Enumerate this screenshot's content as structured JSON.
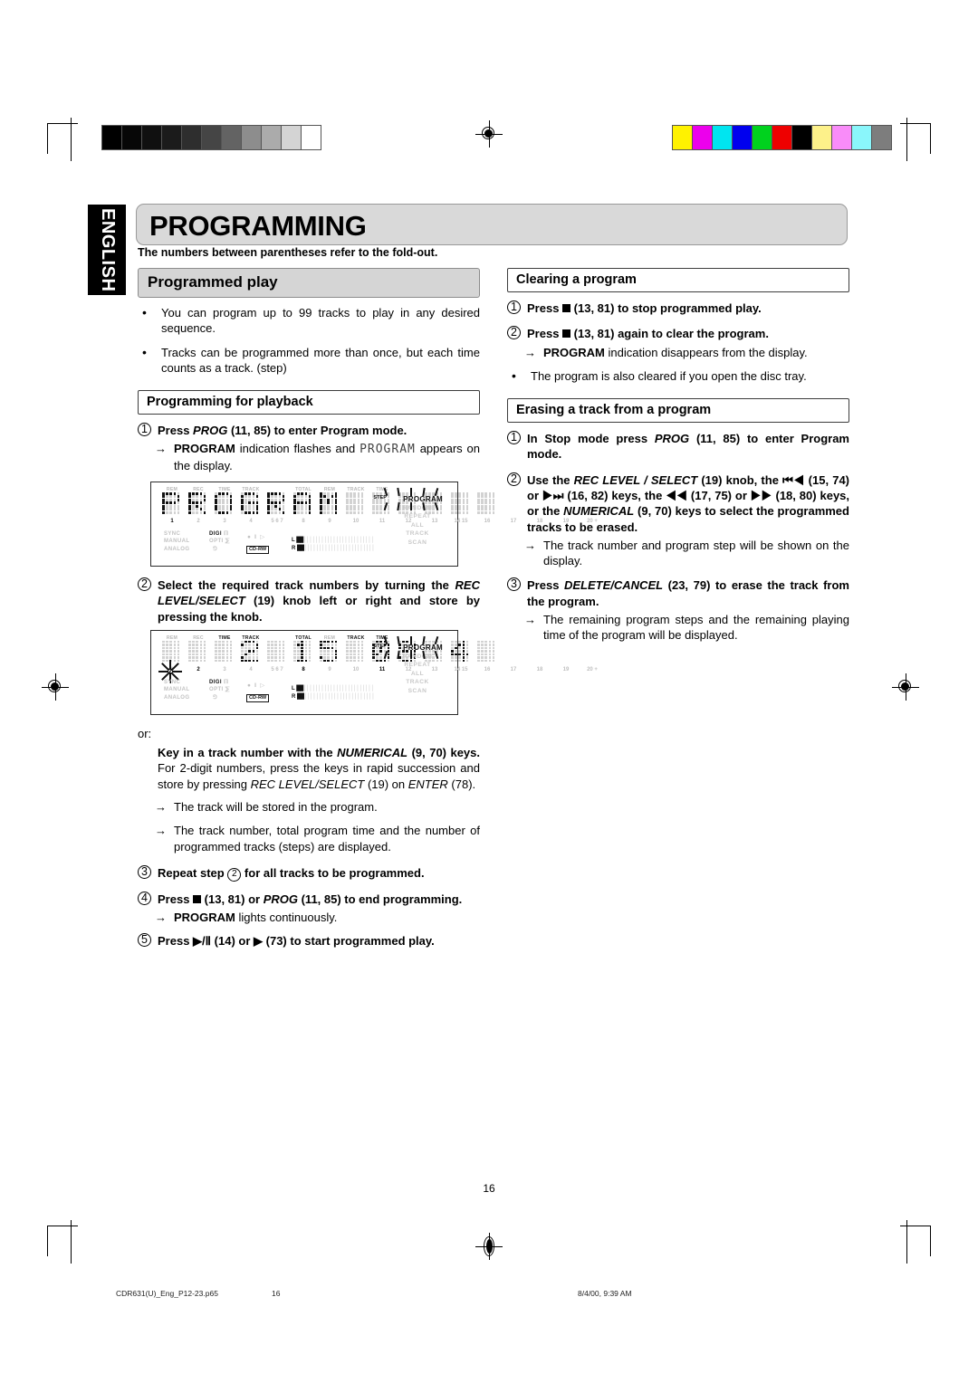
{
  "page": {
    "language_tab": "ENGLISH",
    "chapter_title": "PROGRAMMING",
    "note": "The numbers between parentheses refer to the fold-out.",
    "page_number": "16"
  },
  "footer": {
    "file": "CDR631(U)_Eng_P12-23.p65",
    "page": "16",
    "timestamp": "8/4/00, 9:39 AM"
  },
  "left_column": {
    "section_title": "Programmed play",
    "bullets": [
      "You can program up to 99 tracks to play in any desired sequence.",
      "Tracks can be programmed more than once, but each time counts as a track. (step)"
    ],
    "subsection_title": "Programming for playback",
    "step1": {
      "marker": "1",
      "text_pre": "Press ",
      "text_em": "PROG",
      "text_post": " (11, 85) to enter Program mode.",
      "result_pre": "PROGRAM",
      "result_mid": " indication flashes and ",
      "result_lcd": "PROGRAM",
      "result_post": " appears on the display."
    },
    "step2": {
      "marker": "2",
      "line1_pre": "Select the required track numbers by turning the ",
      "line1_em": "REC LEVEL/SELECT",
      "line1_post": " (19) knob left or right and store by pressing the knob."
    },
    "or_label": "or:",
    "keyin": {
      "bold_pre": "Key in a track number with the ",
      "bold_em": "NUMERICAL",
      "bold_post": " (9, 70) keys.",
      "rest_a": " For 2-digit numbers, press the keys in rapid succession and store by pressing ",
      "rest_em": "REC LEVEL/SELECT",
      "rest_b": " (19) on ",
      "rest_em2": "ENTER",
      "rest_c": " (78).",
      "arrow1": "The track will be stored in the program.",
      "arrow2": "The track number, total program time and the number of programmed tracks (steps) are displayed."
    },
    "step3": {
      "marker": "3",
      "text_a": "Repeat step ",
      "ref": "2",
      "text_b": " for all tracks to be programmed."
    },
    "step4": {
      "marker": "4",
      "text_a": "Press ",
      "text_b": " (13, 81) or ",
      "em": "PROG",
      "text_c": " (11, 85) to end programming.",
      "result_bold": "PROGRAM",
      "result_rest": " lights continuously."
    },
    "step5": {
      "marker": "5",
      "text_a": "Press ",
      "glyph1": "▶/Ⅱ",
      "text_b": " (14) or ",
      "glyph2": "▶",
      "text_c": " (73) to start programmed play."
    }
  },
  "right_column": {
    "section1_title": "Clearing a program",
    "s1_step1": {
      "marker": "1",
      "text_a": "Press ",
      "text_b": " (13, 81) to stop programmed play."
    },
    "s1_step2": {
      "marker": "2",
      "text_a": "Press ",
      "text_b": " (13, 81) again to clear the program.",
      "result_bold": "PROGRAM",
      "result_rest": " indication disappears from the display."
    },
    "s1_bullet": "The program is also cleared if you open the disc tray.",
    "section2_title": "Erasing a track from a program",
    "s2_step1": {
      "marker": "1",
      "text_a": "In Stop mode press ",
      "em": "PROG",
      "text_b": " (11, 85) to enter Program mode."
    },
    "s2_step2": {
      "marker": "2",
      "text_a": "Use the ",
      "em1": "REC LEVEL / SELECT",
      "text_b": " (19) knob, the ",
      "g1": "⏮◀",
      "text_c": " (15, 74) or ",
      "g2": "▶⏭",
      "text_d": " (16, 82) keys, the ",
      "g3": "◀◀",
      "text_e": " (17, 75) or ",
      "g4": "▶▶",
      "text_f": " (18, 80) keys, or the ",
      "em2": "NUMERICAL",
      "text_g": " (9, 70) keys to select the programmed tracks to be erased.",
      "result": "The track number and program step will be shown on the display."
    },
    "s2_step3": {
      "marker": "3",
      "text_a": "Press ",
      "em": "DELETE/CANCEL",
      "text_b": " (23, 79) to erase the track from the program.",
      "result": "The remaining program steps and the remaining playing time of the program will be displayed."
    }
  },
  "lcd_display_1": {
    "caption": "PROGRAM",
    "segment_text": "PROGRAM",
    "top_labels": [
      "REM",
      "REC",
      "TIME",
      "TRACK",
      "",
      "TOTAL",
      "REM",
      "TRACK",
      "TIME",
      "",
      "",
      "",
      ""
    ],
    "active_top_labels": [],
    "track_numbers": [
      "1",
      "2",
      "3",
      "4",
      "5 6 7",
      "8",
      "9",
      "10",
      "11",
      "12",
      "13",
      "14 15",
      "16",
      "17",
      "18",
      "19",
      "20 +"
    ],
    "lit_track_numbers": [
      "1"
    ],
    "left_labels": [
      "SYNC",
      "MANUAL",
      "ANALOG"
    ],
    "mid_labels": [
      "DIGI",
      "OPTI"
    ],
    "cdrw_label": "CD-RW",
    "meter_left": "L",
    "meter_right": "R",
    "mode_labels": [
      "RANDOM",
      "REPEAT",
      "ALL",
      "TRACK",
      "SCAN"
    ],
    "program_label": "PROGRAM",
    "step_label": "STEP",
    "program_flashing": true
  },
  "lcd_display_2": {
    "caption": "2 15 09 4",
    "track_number": "2",
    "total_time": "15:09",
    "step_count": "4",
    "top_labels": [
      "REM",
      "REC",
      "TIME",
      "TRACK",
      "",
      "TOTAL",
      "REM",
      "TRACK",
      "TIME",
      "",
      "",
      "",
      ""
    ],
    "active_top_labels": [
      "TRACK",
      "TOTAL",
      "TRACK",
      "TIME"
    ],
    "track_numbers": [
      "1",
      "2",
      "3",
      "4",
      "5 6 7",
      "8",
      "9",
      "10",
      "11",
      "12",
      "13",
      "14 15",
      "16",
      "17",
      "18",
      "19",
      "20 +"
    ],
    "lit_track_numbers": [
      "2",
      "7",
      "8",
      "11"
    ],
    "left_labels": [
      "SYNC",
      "MANUAL",
      "ANALOG"
    ],
    "mid_labels": [
      "DIGI",
      "OPTI"
    ],
    "cdrw_label": "CD-RW",
    "meter_left": "L",
    "meter_right": "R",
    "mode_labels": [
      "RANDOM",
      "REPEAT",
      "ALL",
      "TRACK",
      "SCAN"
    ],
    "program_label": "PROGRAM",
    "step_label": "STEP",
    "program_flashing": true
  },
  "print_marks": {
    "grayscale_steps": [
      "#000000",
      "#070707",
      "#101010",
      "#1b1b1b",
      "#2e2e2e",
      "#454545",
      "#636363",
      "#8d8d8d",
      "#ababab",
      "#d4d4d4",
      "#ffffff"
    ],
    "color_steps": [
      "#fff200",
      "#ec00ec",
      "#00e5f0",
      "#0000ee",
      "#00d21e",
      "#ee0000",
      "#000000",
      "#fdf18a",
      "#f98cf9",
      "#8af6fb",
      "#7d7d7d"
    ]
  }
}
